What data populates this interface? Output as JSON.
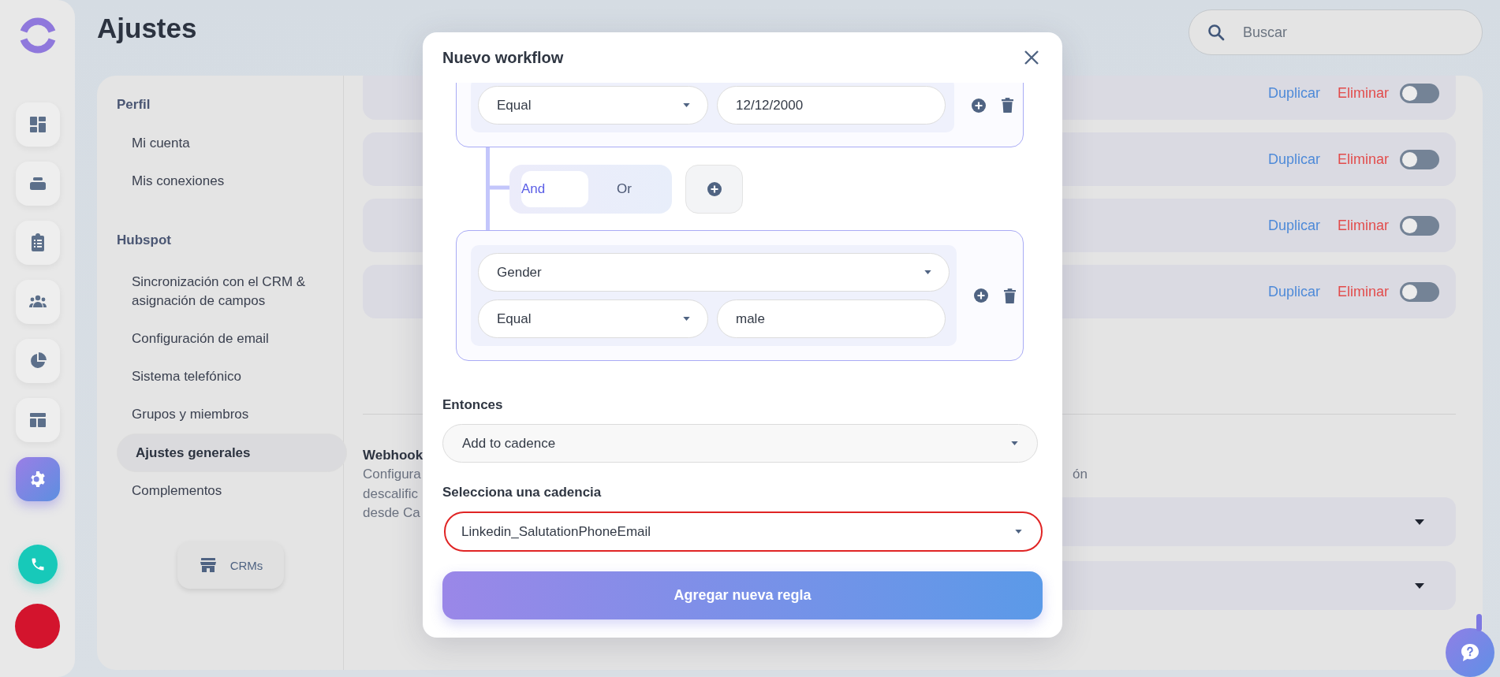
{
  "rail_items": [
    {
      "selected": false
    },
    {
      "selected": false
    },
    {
      "selected": false
    },
    {
      "selected": false
    },
    {
      "selected": false
    },
    {
      "selected": false
    },
    {
      "selected": true
    }
  ],
  "page_title": "Ajustes",
  "search": {
    "placeholder": "Buscar"
  },
  "settings_nav": [
    {
      "title": "Perfil",
      "items": [
        {
          "label": "Mi cuenta",
          "selected": false
        },
        {
          "label": "Mis conexiones",
          "selected": false
        }
      ]
    },
    {
      "title": "Hubspot",
      "items": [
        {
          "label": "Sincronización con el CRM & asignación de campos",
          "selected": false
        },
        {
          "label": "Configuración de email",
          "selected": false
        },
        {
          "label": "Sistema telefónico",
          "selected": false
        },
        {
          "label": "Grupos y miembros",
          "selected": false
        },
        {
          "label": "Ajustes generales",
          "selected": true
        },
        {
          "label": "Complementos",
          "selected": false
        }
      ]
    }
  ],
  "crm_button": {
    "label": "CRMs"
  },
  "rules": [
    {
      "duplicate": "Duplicar",
      "delete": "Eliminar",
      "on": false
    },
    {
      "duplicate": "Duplicar",
      "delete": "Eliminar",
      "on": false
    },
    {
      "duplicate": "Duplicar",
      "delete": "Eliminar",
      "on": false
    },
    {
      "duplicate": "Duplicar",
      "delete": "Eliminar",
      "on": false
    }
  ],
  "webhooks": {
    "title": "Webhook",
    "description_lines": [
      "Configura",
      "descalific",
      "desde Ca"
    ],
    "right_text": "ón"
  },
  "modal": {
    "title": "Nuevo workflow",
    "conditions": [
      {
        "operator": "Equal",
        "value": "12/12/2000"
      },
      {
        "field": "Gender",
        "operator": "Equal",
        "value": "male"
      }
    ],
    "logic": [
      {
        "label": "And",
        "selected": true
      },
      {
        "label": "Or",
        "selected": false
      }
    ],
    "then_label": "Entonces",
    "action": "Add to cadence",
    "cadence_label": "Selecciona una cadencia",
    "cadence": {
      "value": "Linkedin_SalutationPhoneEmail",
      "invalid": true
    },
    "submit": "Agregar nueva regla"
  }
}
